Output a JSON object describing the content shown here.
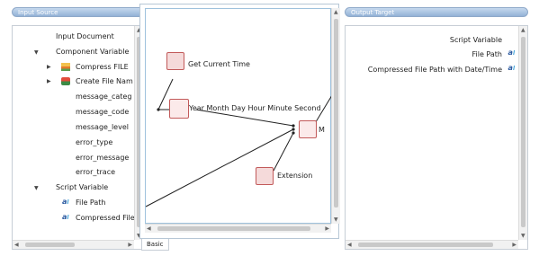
{
  "left_panel": {
    "title": "Input Source",
    "rows": {
      "input_document": "Input Document",
      "component_variable": "Component Variable",
      "compress_file": "Compress FILE",
      "create_file_name": "Create File Nam",
      "message_category": "message_categ",
      "message_code": "message_code",
      "message_level": "message_level",
      "error_type": "error_type",
      "error_message": "error_message",
      "error_trace": "error_trace",
      "script_variable": "Script Variable",
      "file_path": "File Path",
      "compressed_file": "Compressed File"
    }
  },
  "canvas": {
    "nodes": {
      "get_current_time": "Get Current Time",
      "date_format": "Year Month Day Hour Minute Second",
      "extension": "Extension",
      "concat_label": "M"
    },
    "tab": "Basic"
  },
  "right_panel": {
    "title": "Output Target",
    "rows": {
      "script_variable": "Script Variable",
      "file_path": "File Path",
      "compressed_path": "Compressed File Path with Date/Time"
    }
  },
  "icons": {
    "variable": "variable-icon",
    "folder": "component-folder-icon",
    "function": "function-node-icon"
  },
  "colors": {
    "header": "#93b2d6",
    "node_border": "#c25a5a",
    "variable_icon": "#2c5aa0"
  }
}
